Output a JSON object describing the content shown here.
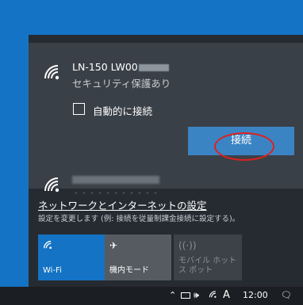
{
  "network1": {
    "name": "LN-150 LW00",
    "status": "セキュリティ保護あり",
    "auto_connect_label": "自動的に接続",
    "connect_label": "接続"
  },
  "settings": {
    "link_label": "ネットワークとインターネットの設定",
    "description": "設定を変更します (例: 接続を従量制課金接続に設定する)。"
  },
  "quick_actions": {
    "wifi_label": "Wi-Fi",
    "airplane_label": "機内モード",
    "hotspot_label": "モバイル ホットス ポット"
  },
  "taskbar": {
    "clock": "12:00",
    "ime_label": "A"
  },
  "colors": {
    "accent": "#1473c4",
    "highlight_ellipse": "#e0201c"
  }
}
